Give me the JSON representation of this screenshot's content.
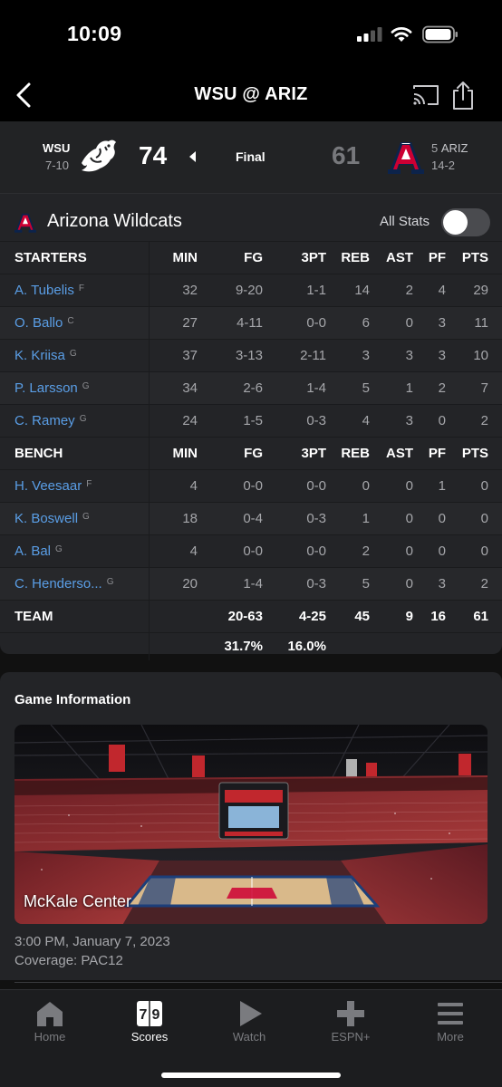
{
  "status_bar": {
    "time": "10:09"
  },
  "nav": {
    "title": "WSU @ ARIZ"
  },
  "score": {
    "away": {
      "abbr": "WSU",
      "record": "7-10",
      "score": "74"
    },
    "status": "Final",
    "home": {
      "rank": "5",
      "abbr": "ARIZ",
      "record": "14-2",
      "score": "61"
    }
  },
  "box": {
    "team_name": "Arizona Wildcats",
    "all_stats_label": "All Stats",
    "all_stats_on": false,
    "starters_header": [
      "STARTERS",
      "MIN",
      "FG",
      "3PT",
      "REB",
      "AST",
      "PF",
      "PTS"
    ],
    "starters": [
      {
        "name": "A. Tubelis",
        "pos": "F",
        "min": "32",
        "fg": "9-20",
        "tpt": "1-1",
        "reb": "14",
        "ast": "2",
        "pf": "4",
        "pts": "29"
      },
      {
        "name": "O. Ballo",
        "pos": "C",
        "min": "27",
        "fg": "4-11",
        "tpt": "0-0",
        "reb": "6",
        "ast": "0",
        "pf": "3",
        "pts": "11"
      },
      {
        "name": "K. Kriisa",
        "pos": "G",
        "min": "37",
        "fg": "3-13",
        "tpt": "2-11",
        "reb": "3",
        "ast": "3",
        "pf": "3",
        "pts": "10"
      },
      {
        "name": "P. Larsson",
        "pos": "G",
        "min": "34",
        "fg": "2-6",
        "tpt": "1-4",
        "reb": "5",
        "ast": "1",
        "pf": "2",
        "pts": "7"
      },
      {
        "name": "C. Ramey",
        "pos": "G",
        "min": "24",
        "fg": "1-5",
        "tpt": "0-3",
        "reb": "4",
        "ast": "3",
        "pf": "0",
        "pts": "2"
      }
    ],
    "bench_header": [
      "BENCH",
      "MIN",
      "FG",
      "3PT",
      "REB",
      "AST",
      "PF",
      "PTS"
    ],
    "bench": [
      {
        "name": "H. Veesaar",
        "pos": "F",
        "min": "4",
        "fg": "0-0",
        "tpt": "0-0",
        "reb": "0",
        "ast": "0",
        "pf": "1",
        "pts": "0"
      },
      {
        "name": "K. Boswell",
        "pos": "G",
        "min": "18",
        "fg": "0-4",
        "tpt": "0-3",
        "reb": "1",
        "ast": "0",
        "pf": "0",
        "pts": "0"
      },
      {
        "name": "A. Bal",
        "pos": "G",
        "min": "4",
        "fg": "0-0",
        "tpt": "0-0",
        "reb": "2",
        "ast": "0",
        "pf": "0",
        "pts": "0"
      },
      {
        "name": "C. Henderso...",
        "pos": "G",
        "min": "20",
        "fg": "1-4",
        "tpt": "0-3",
        "reb": "5",
        "ast": "0",
        "pf": "3",
        "pts": "2"
      }
    ],
    "team_totals": {
      "label": "TEAM",
      "min": "",
      "fg": "20-63",
      "tpt": "4-25",
      "reb": "45",
      "ast": "9",
      "pf": "16",
      "pts": "61"
    },
    "percentages": {
      "fg_pct": "31.7%",
      "tpt_pct": "16.0%"
    }
  },
  "game_info": {
    "title": "Game Information",
    "venue": "McKale Center",
    "date_time": "3:00 PM, January 7, 2023",
    "coverage": "Coverage: PAC12"
  },
  "tabs": [
    {
      "label": "Home",
      "icon": "home-icon",
      "active": false
    },
    {
      "label": "Scores",
      "icon": "scores-icon",
      "active": true
    },
    {
      "label": "Watch",
      "icon": "play-icon",
      "active": false
    },
    {
      "label": "ESPN+",
      "icon": "espn-plus-icon",
      "active": false
    },
    {
      "label": "More",
      "icon": "menu-icon",
      "active": false
    }
  ],
  "colors": {
    "link_blue": "#5a9ee6",
    "arizona_red": "#cc0033",
    "arizona_navy": "#0c234b",
    "card_bg": "#232427"
  }
}
